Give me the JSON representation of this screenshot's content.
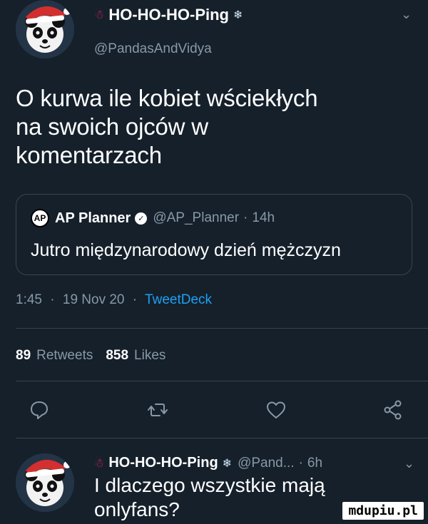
{
  "main_tweet": {
    "display_name": "HO-HO-HO-Ping",
    "handle": "@PandasAndVidya",
    "text_lines": [
      "O kurwa ile kobiet wściekłych",
      "na swoich ojców w",
      "komentarzach"
    ],
    "quoted": {
      "logo_text": "AP",
      "name": "AP Planner",
      "handle": "@AP_Planner",
      "sep": "·",
      "time": "14h",
      "text": "Jutro międzynarodowy dzień mężczyzn"
    },
    "meta": {
      "time": "1:45",
      "sep1": "·",
      "date": "19 Nov 20",
      "sep2": "·",
      "client": "TweetDeck"
    },
    "stats": {
      "retweets_count": "89",
      "retweets_label": "Retweets",
      "likes_count": "858",
      "likes_label": "Likes"
    }
  },
  "reply_tweet": {
    "display_name": "HO-HO-HO-Ping",
    "handle": "@Pand...",
    "sep": "·",
    "time": "6h",
    "text_lines": [
      "I dlaczego wszystkie mają",
      "onlyfans?"
    ]
  },
  "watermark": "mdupiu.pl",
  "icons": [
    "avatar-panda-santa",
    "santa-emoji",
    "snowman-emoji",
    "chevron-down-icon",
    "verified-badge-icon",
    "reply-icon",
    "retweet-icon",
    "like-icon",
    "share-icon"
  ],
  "colors": {
    "background": "#15202b",
    "text": "#ffffff",
    "muted": "#8899a6",
    "link": "#1da1f2",
    "border": "#38444d"
  }
}
